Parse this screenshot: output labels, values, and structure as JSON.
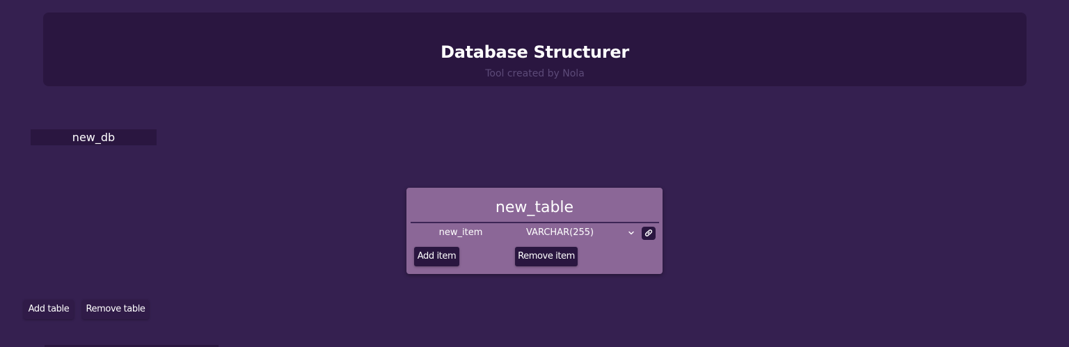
{
  "header": {
    "title": "Database Structurer",
    "subtitle": "Tool created by Nola"
  },
  "database": {
    "name": "new_db"
  },
  "table": {
    "name": "new_table",
    "items": [
      {
        "name": "new_item",
        "type": "VARCHAR(255)"
      }
    ],
    "add_item_label": "Add item",
    "remove_item_label": "Remove item"
  },
  "actions": {
    "add_table_label": "Add table",
    "remove_table_label": "Remove table"
  },
  "icons": {
    "type_dropdown": "chevron-down-icon",
    "relation": "link-icon"
  },
  "colors": {
    "background": "#352050",
    "header_bg": "#2a1640",
    "card_bg": "#8b6797",
    "subtitle": "#5c4a78"
  }
}
